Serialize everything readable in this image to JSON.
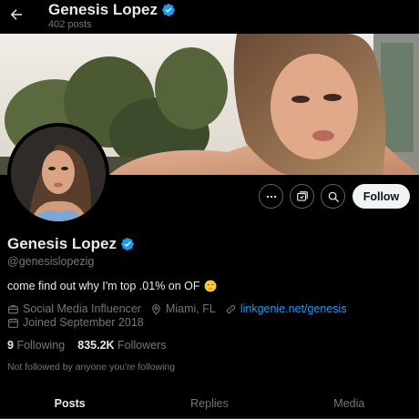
{
  "header": {
    "title": "Genesis Lopez",
    "posts_count": "402 posts"
  },
  "actions": {
    "follow_label": "Follow"
  },
  "profile": {
    "name": "Genesis Lopez",
    "handle": "@genesislopezig",
    "bio": "come find out why I'm top .01% on OF",
    "category": "Social Media Influencer",
    "location": "Miami, FL",
    "link": "linkgenie.net/genesis",
    "joined": "Joined September 2018"
  },
  "stats": {
    "following_count": "9",
    "following_label": "Following",
    "followers_count": "835.2K",
    "followers_label": "Followers"
  },
  "not_followed_text": "Not followed by anyone you're following",
  "tabs": [
    {
      "label": "Posts",
      "active": true
    },
    {
      "label": "Replies",
      "active": false
    },
    {
      "label": "Media",
      "active": false
    }
  ],
  "colors": {
    "background": "#000000",
    "text_primary": "#e7e9ea",
    "text_secondary": "#71767b",
    "link": "#1d9bf0",
    "verified": "#1d9bf0",
    "follow_button_bg": "#eff3f4"
  },
  "icons": {
    "back": "arrow-left-icon",
    "verified": "verified-badge-icon",
    "more": "more-dots-icon",
    "subscribe": "subscribe-icon",
    "search": "search-icon",
    "category": "briefcase-icon",
    "location": "location-pin-icon",
    "link": "link-icon",
    "calendar": "calendar-icon",
    "emoji": "shushing-face-emoji"
  }
}
